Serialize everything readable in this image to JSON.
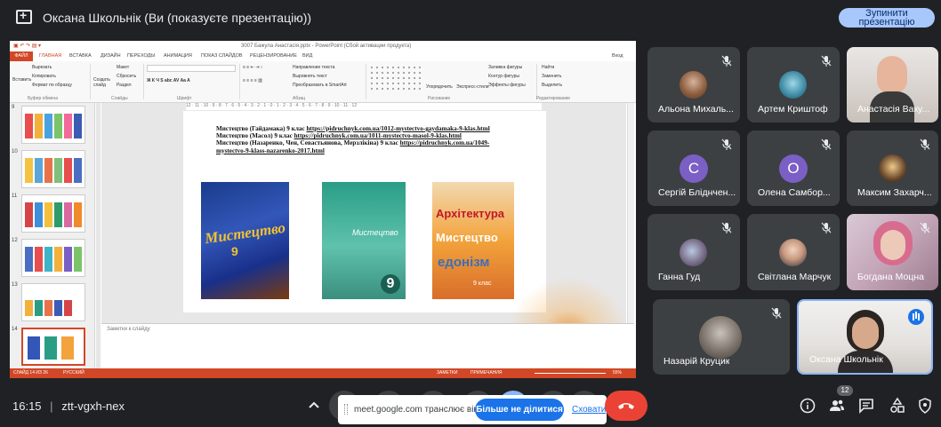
{
  "topbar": {
    "presenter_text": "Оксана Школьнік (Ви (показуєте презентацію))",
    "stop_button": "Зупинити презентацію"
  },
  "powerpoint": {
    "title": "3007 Бажула Анастасія.pptx - PowerPoint (Сбой активации продукта)",
    "tabs": [
      "ФАЙЛ",
      "ГЛАВНАЯ",
      "ВСТАВКА",
      "ДИЗАЙН",
      "ПЕРЕХОДЫ",
      "АНИМАЦИЯ",
      "ПОКАЗ СЛАЙДОВ",
      "РЕЦЕНЗИРОВАНИЕ",
      "ВИД"
    ],
    "signin": "Вход",
    "ribbon": {
      "paste": "Вставить",
      "cut": "Вырезать",
      "copy": "Копировать",
      "format_painter": "Формат по образцу",
      "create_slide": "Создать слайд",
      "layout": "Макет",
      "reset": "Сбросить",
      "section": "Раздел",
      "text_direction": "Направление текста",
      "align_text": "Выровнять текст",
      "smartart": "Преобразовать в SmartArt",
      "arrange": "Упорядочить",
      "quick_styles": "Экспресс-стили",
      "shape_fill": "Заливка фигуры",
      "shape_outline": "Контур фигуры",
      "shape_effects": "Эффекты фигуры",
      "find": "Найти",
      "replace": "Заменить",
      "select": "Выделить",
      "groups": [
        "Буфер обмена",
        "Слайды",
        "Шрифт",
        "Абзац",
        "Рисование",
        "Редактирование"
      ]
    },
    "thumb_numbers": [
      "9",
      "10",
      "11",
      "12",
      "13",
      "14"
    ],
    "ruler": "12 · 11 · 10 · 9 · 8 · 7 · 6 · 5 · 4 · 3 · 2 · 1 · 0 · 1 · 2 · 3 · 4 · 5 · 6 · 7 · 8 · 9 · 10 · 11 · 12",
    "slide": {
      "line1_text": "Мистецтво (Гайдамака) 9 клас ",
      "line1_link": "https://pidruchnyk.com.ua/1012-mystectvo-gaydamaka-9-klas.html",
      "line2_text": "Мистецтво (Масол) 9 клас ",
      "line2_link": "https://pidruchnyk.com.ua/1011-mystectvo-masol-9-klas.html",
      "line3_text": "Мистецтво (Назаренко, Чен, Севастьянова, Мерзлікіна) 9 клас ",
      "line3_link": "https://pidruchnyk.com.ua/1049-mystectvo-9-klass-nazarenko-2017.html",
      "book1_title": "Мистецтво",
      "book1_grade": "9",
      "book2_title": "Мистецтво",
      "book2_grade": "9",
      "book3_line1": "Архітектура",
      "book3_line2": "Мистецтво",
      "book3_line3": "едонізм",
      "book3_grade": "9 клас"
    },
    "notes_placeholder": "Заметки к слайду",
    "status_slide": "СЛАЙД 14 ИЗ 26",
    "status_lang": "РУССКИЙ",
    "status_notes": "ЗАМЕТКИ",
    "status_comments": "ПРИМЕЧАНИЯ",
    "zoom": "55%"
  },
  "participants": [
    {
      "name": "Альона Михаль...",
      "muted": true
    },
    {
      "name": "Артем Криштоф",
      "muted": true
    },
    {
      "name": "Анастасія Baкy...",
      "muted": false
    },
    {
      "name": "Сергій Бліднчен...",
      "muted": true,
      "letter": "С"
    },
    {
      "name": "Олена Самбор...",
      "muted": true,
      "letter": "О"
    },
    {
      "name": "Максим Захарч...",
      "muted": true
    },
    {
      "name": "Ганна Гуд",
      "muted": true
    },
    {
      "name": "Світлана Марчук",
      "muted": true
    },
    {
      "name": "Богдана Моцна",
      "muted": true
    },
    {
      "name": "Назарій Круцик",
      "muted": true
    },
    {
      "name": "Оксана Школьнік",
      "muted": false,
      "speaking": true
    }
  ],
  "bottombar": {
    "time": "16:15",
    "separator": "|",
    "meeting_code": "ztt-vgxh-nex",
    "participant_count": "12",
    "toast": {
      "message": "meet.google.com транслює вікно.",
      "stop_sharing": "Більше не ділитися",
      "hide": "Сховати"
    }
  },
  "colors": {
    "background": "#202124",
    "tile": "#3c4043",
    "accent_blue": "#8ab4f8",
    "powerpoint_orange": "#d24726",
    "hangup_red": "#ea4335"
  }
}
